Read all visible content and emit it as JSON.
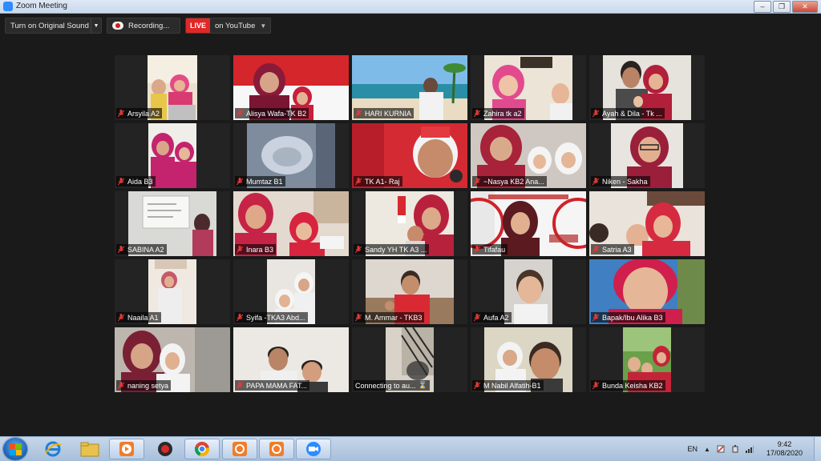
{
  "window": {
    "title": "Zoom Meeting"
  },
  "toolbar": {
    "sound_label": "Turn on Original Sound",
    "recording_label": "Recording...",
    "live_badge": "LIVE",
    "live_target": "on YouTube"
  },
  "participants": [
    "Arsyila A2",
    "Alisya Wafa-TK B2",
    "HARI KURNIA",
    "Zahira tk a2",
    "Ayah & Dila - Tk ...",
    "Aida B3",
    "Mumtaz B1",
    "TK A1- Raj",
    "~Nasya KB2 Ana...",
    "Niken - Sakha",
    "SABINA A2",
    "Inara B3",
    "Sandy YH TK A3 ...",
    "Tifafau",
    "Satria A3",
    "Naaila A1",
    "Syifa -TKA3 Abd...",
    "M. Ammar - TKB3",
    "Aufa A2",
    "Bapak/Ibu Alika B3",
    "naning setya",
    "PAPA MAMA FAT...",
    "Connecting to au...",
    "M Nabil Alfatih-B1",
    "Bunda Keisha KB2"
  ],
  "taskbar": {
    "language": "EN",
    "time": "9:42",
    "date": "17/08/2020"
  },
  "colors": {
    "live_red": "#e02828",
    "mic_muted_red": "#e53935",
    "zoom_blue": "#2d8cff"
  }
}
